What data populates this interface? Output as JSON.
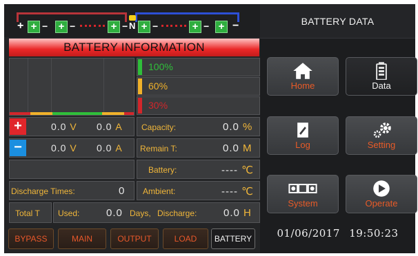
{
  "header": {
    "title": "BATTERY INFORMATION",
    "panel_title": "BATTERY DATA",
    "neutral_label": "N"
  },
  "battery_string": {
    "cells": [
      "+",
      "+",
      "+",
      "+",
      "+",
      "+"
    ],
    "left_terminal": "+",
    "right_terminal": "−"
  },
  "levels": [
    {
      "label": "100%",
      "color": "#2fbf3a"
    },
    {
      "label": "60%",
      "color": "#f0b12a"
    },
    {
      "label": "30%",
      "color": "#d2262b"
    }
  ],
  "positive": {
    "sign": "+",
    "voltage": "0.0",
    "voltage_unit": "V",
    "current": "0.0",
    "current_unit": "A",
    "color": "#e0262b"
  },
  "negative": {
    "sign": "−",
    "voltage": "0.0",
    "voltage_unit": "V",
    "current": "0.0",
    "current_unit": "A",
    "color": "#1b8fe0"
  },
  "stats": {
    "capacity_label": "Capacity:",
    "capacity_value": "0.0",
    "capacity_unit": "%",
    "remain_label": "Remain T:",
    "remain_value": "0.0",
    "remain_unit": "M",
    "battery_label": "Battery:",
    "battery_value": "----",
    "battery_unit": "℃",
    "ambient_label": "Ambient:",
    "ambient_value": "----",
    "ambient_unit": "℃",
    "discharge_times_label": "Discharge Times:",
    "discharge_times_value": "0"
  },
  "totals": {
    "total_label": "Total T",
    "used_label": "Used:",
    "used_value": "0.0",
    "days_label": "Days,",
    "discharge_label": "Discharge:",
    "discharge_value": "0.0",
    "discharge_unit": "H"
  },
  "tabs": [
    {
      "label": "BYPASS",
      "active": false
    },
    {
      "label": "MAIN",
      "active": false
    },
    {
      "label": "OUTPUT",
      "active": false
    },
    {
      "label": "LOAD",
      "active": false
    },
    {
      "label": "BATTERY",
      "active": true
    }
  ],
  "nav": {
    "home": {
      "label": "Home",
      "icon": "home-icon"
    },
    "data": {
      "label": "Data",
      "icon": "battery-icon"
    },
    "log": {
      "label": "Log",
      "icon": "log-icon"
    },
    "setting": {
      "label": "Setting",
      "icon": "gear-icon"
    },
    "system": {
      "label": "System",
      "icon": "system-icon"
    },
    "operate": {
      "label": "Operate",
      "icon": "play-icon"
    }
  },
  "status": {
    "date": "01/06/2017",
    "time": "19:50:23"
  },
  "colors": {
    "accent": "#e85b28",
    "title_red": "#ea2828",
    "label_amber": "#f0b63a",
    "cell_green": "#2fae3f",
    "wire_blue": "#2d4fd6",
    "wire_red": "#b8343a"
  }
}
